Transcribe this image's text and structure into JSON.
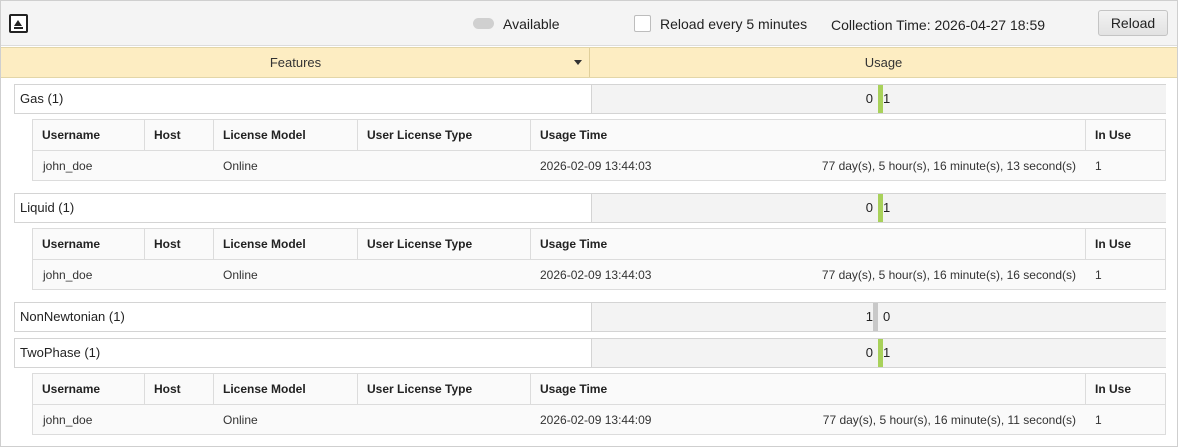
{
  "toolbar": {
    "available_label": "Available",
    "reload_checkbox_label": "Reload every 5 minutes",
    "collection_time": "Collection Time: 2026-04-27 18:59",
    "reload_button": "Reload"
  },
  "columns": {
    "features": "Features",
    "usage": "Usage"
  },
  "detail_headers": {
    "username": "Username",
    "host": "Host",
    "license_model": "License Model",
    "user_license_type": "User License Type",
    "usage_time": "Usage Time",
    "in_use": "In Use"
  },
  "features": [
    {
      "name": "Gas (1)",
      "available": "0",
      "used": "1",
      "bar_color": "#a8d15a",
      "users": [
        {
          "username": "john_doe",
          "host": "",
          "license_model": "Online",
          "user_license_type": "",
          "usage_time": "2026-02-09 13:44:03",
          "duration": "77 day(s), 5 hour(s), 16 minute(s), 13 second(s)",
          "in_use": "1"
        }
      ]
    },
    {
      "name": "Liquid (1)",
      "available": "0",
      "used": "1",
      "bar_color": "#a8d15a",
      "users": [
        {
          "username": "john_doe",
          "host": "",
          "license_model": "Online",
          "user_license_type": "",
          "usage_time": "2026-02-09 13:44:03",
          "duration": "77 day(s), 5 hour(s), 16 minute(s), 16 second(s)",
          "in_use": "1"
        }
      ]
    },
    {
      "name": "NonNewtonian (1)",
      "available": "1",
      "used": "0",
      "bar_color": "#c8c8c8",
      "users": []
    },
    {
      "name": "TwoPhase (1)",
      "available": "0",
      "used": "1",
      "bar_color": "#a8d15a",
      "users": [
        {
          "username": "john_doe",
          "host": "",
          "license_model": "Online",
          "user_license_type": "",
          "usage_time": "2026-02-09 13:44:09",
          "duration": "77 day(s), 5 hour(s), 16 minute(s), 11 second(s)",
          "in_use": "1"
        }
      ]
    }
  ]
}
